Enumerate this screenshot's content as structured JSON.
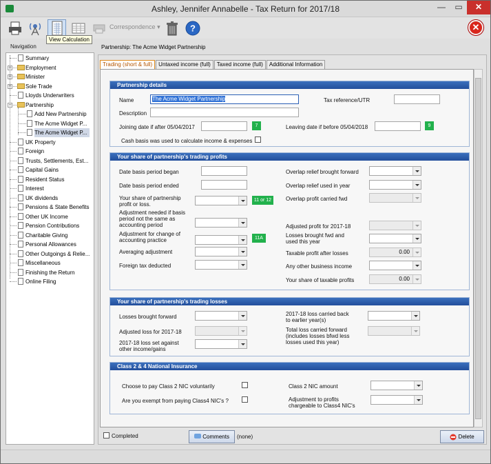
{
  "window": {
    "title": "Ashley, Jennifer Annabelle - Tax Return for 2017/18",
    "minimize": "—",
    "maximize": "▭",
    "close": "✕"
  },
  "toolbar": {
    "tooltip": "View Calculation",
    "correspondence": "Correspondence",
    "correspondence_arrow": "▾",
    "exit": "✕"
  },
  "nav": {
    "header": "Navigation",
    "items": [
      "Summary",
      "Employment",
      "Minister",
      "Sole Trade",
      "Lloyds Underwriters",
      "Partnership",
      "Add New Partnership",
      "The Acme Widget P...",
      "The Acme Widget P...",
      "UK Property",
      "Foreign",
      "Trusts, Settlements, Est...",
      "Capital Gains",
      "Resident Status",
      "Interest",
      "UK dividends",
      "Pensions & State Benefits",
      "Other UK Income",
      "Pension Contributions",
      "Charitable Giving",
      "Personal Allowances",
      "Other Outgoings & Relie...",
      "Miscellaneous",
      "Finishing the Return",
      "Online Filing"
    ],
    "expand_plus": "+",
    "expand_minus": "−"
  },
  "main": {
    "heading": "Partnership: The Acme Widget Partnership",
    "tabs": [
      "Trading (short & full)",
      "Untaxed income (full)",
      "Taxed income (full)",
      "Additional Information"
    ]
  },
  "details": {
    "header": "Partnership details",
    "name_label": "Name",
    "name_value": "The Acme Widget Partnership",
    "utr_label": "Tax reference/UTR",
    "desc_label": "Description",
    "joining_label": "Joining date if after 05/04/2017",
    "joining_box": "7",
    "leaving_label": "Leaving date if before 05/04/2018",
    "leaving_box": "9",
    "cash_basis_label": "Cash basis was used to calculate income & expenses"
  },
  "profits": {
    "header": "Your share of partnership's trading profits",
    "basis_began": "Date basis period began",
    "basis_ended": "Date basis period ended",
    "share_profit": "Your share of partnership profit or loss.",
    "share_box": "11 or 12",
    "adj_basis": "Adjustment needed if basis period not the same as accounting period",
    "adj_change": "Adjustment for change of accounting practice",
    "adj_change_box": "11A",
    "averaging": "Averaging adjustment",
    "foreign_tax": "Foreign tax deducted",
    "overlap_bf": "Overlap relief brought forward",
    "overlap_used": "Overlap relief used in year",
    "overlap_cf": "Overlap profit carried fwd",
    "adjusted_profit": "Adjusted profit for 2017-18",
    "losses_bf_used": "Losses brought fwd and used this year",
    "taxable_after_losses": "Taxable profit after losses",
    "taxable_after_losses_value": "0.00",
    "other_business": "Any other business income",
    "share_taxable": "Your share of taxable profits",
    "share_taxable_value": "0.00"
  },
  "losses": {
    "header": "Your share of partnership's trading losses",
    "losses_bf": "Losses brought forward",
    "adjusted_loss": "Adjusted loss for 2017-18",
    "loss_set_against": "2017-18 loss set against other income/gains",
    "loss_carried_back": "2017-18 loss carried back to earlier year(s)",
    "total_loss_cf": "Total loss carried forward (includes losses bfwd less losses used this year)"
  },
  "nic": {
    "header": "Class 2 & 4 National Insurance",
    "choose_class2": "Choose to pay Class 2 NIC voluntarily",
    "exempt_class4": "Are you exempt from paying Class4 NIC's ?",
    "class2_amount": "Class 2 NIC amount",
    "adjustment_class4": "Adjustment to profits chargeable to Class4 NIC's"
  },
  "footer": {
    "completed": "Completed",
    "comments": "Comments",
    "none": "(none)",
    "delete": "Delete"
  }
}
